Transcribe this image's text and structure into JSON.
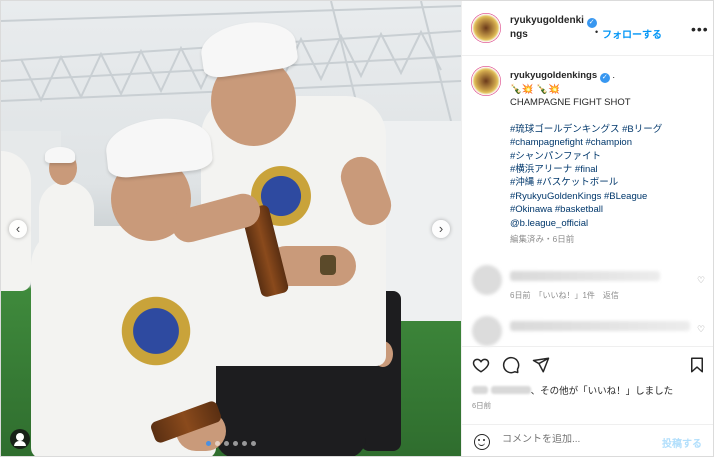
{
  "header": {
    "username_line1": "ryukyugoldenki",
    "username_line2": "ngs",
    "verified_icon": "verified-badge-icon",
    "bullet": "•",
    "follow_label": "フォローする",
    "more_label": "•••"
  },
  "post": {
    "username": "ryukyugoldenkings",
    "emoji_line": "🍾💥 🍾💥",
    "title": "CHAMPAGNE FIGHT SHOT",
    "hashtags": [
      "#琉球ゴールデンキングス #Bリーグ",
      "#champagnefight #champion",
      "#シャンパンファイト",
      "#横浜アリーナ #final",
      "#沖縄 #バスケットボール",
      "#RyukyuGoldenKings #BLeague",
      "#Okinawa #basketball",
      "@b.league_official"
    ],
    "meta": "編集済み・6日前"
  },
  "comments": [
    {
      "meta": "6日前　「いいね！」1件　返信",
      "heart": "♡"
    },
    {
      "meta": "",
      "heart": "♡"
    }
  ],
  "actions": {
    "like_icon": "heart-icon",
    "comment_icon": "comment-icon",
    "share_icon": "send-icon",
    "save_icon": "bookmark-icon",
    "likes_text": "、その他が「いいね！」しました",
    "likes_bold": "その他",
    "date": "6日前"
  },
  "add_comment": {
    "placeholder": "コメントを追加...",
    "post_label": "投稿する"
  },
  "carousel": {
    "prev": "‹",
    "next": "›",
    "slide_count": 6,
    "active_index": 0
  },
  "colors": {
    "accent": "#0095f6",
    "verified": "#3897f0",
    "hashtag": "#00376b"
  }
}
